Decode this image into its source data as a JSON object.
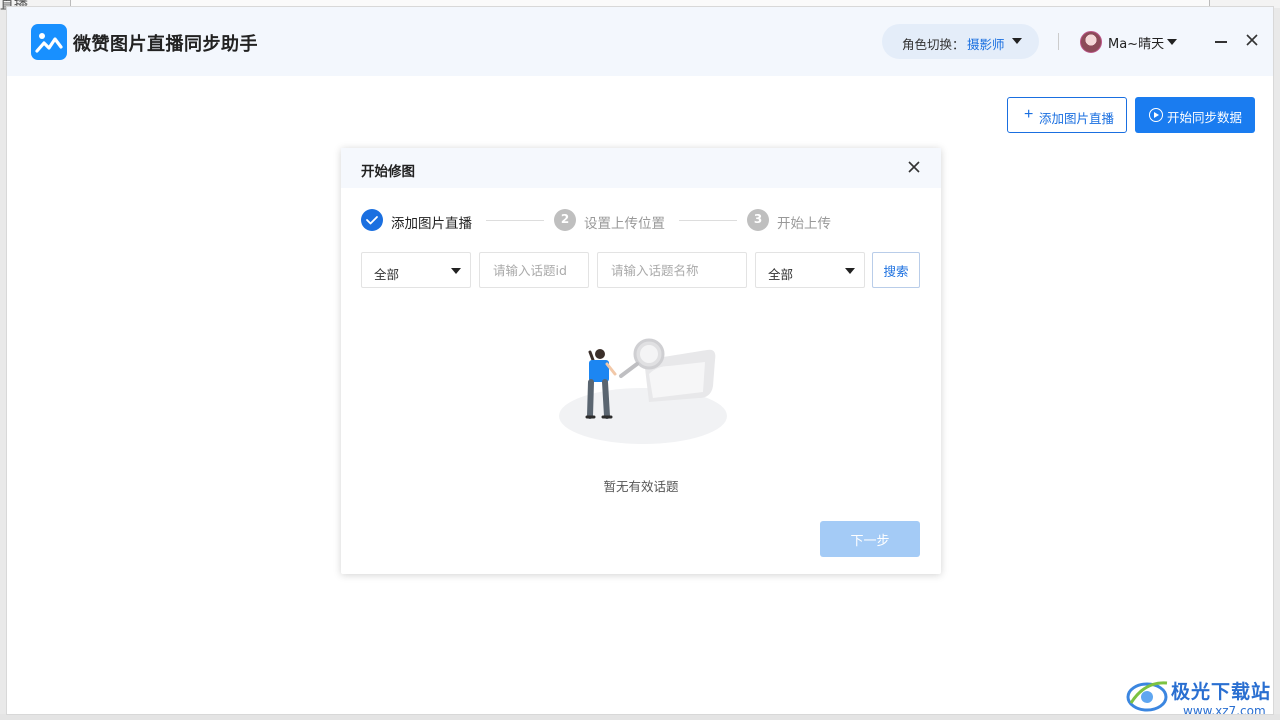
{
  "background": {
    "fragment_text": "直播"
  },
  "app": {
    "title": "微赞图片直播同步助手",
    "role_label": "角色切换：",
    "role_value": "摄影师",
    "user_name": "Ma~晴天"
  },
  "toolbar": {
    "add_label": "添加图片直播",
    "sync_label": "开始同步数据"
  },
  "dialog": {
    "title": "开始修图",
    "steps": [
      {
        "num": "",
        "label": "添加图片直播",
        "state": "done"
      },
      {
        "num": "2",
        "label": "设置上传位置",
        "state": "todo"
      },
      {
        "num": "3",
        "label": "开始上传",
        "state": "todo"
      }
    ],
    "filters": {
      "select1_value": "全部",
      "topic_id_placeholder": "请输入话题id",
      "topic_name_placeholder": "请输入话题名称",
      "select2_value": "全部",
      "search_label": "搜索"
    },
    "empty_text": "暂无有效话题",
    "next_label": "下一步"
  },
  "watermark": {
    "brand": "极光下载站",
    "url": "www.xz7.com"
  },
  "colors": {
    "accent": "#1a6fe0",
    "disabled": "#a4cbf6",
    "header_bg": "#f3f7fd"
  }
}
